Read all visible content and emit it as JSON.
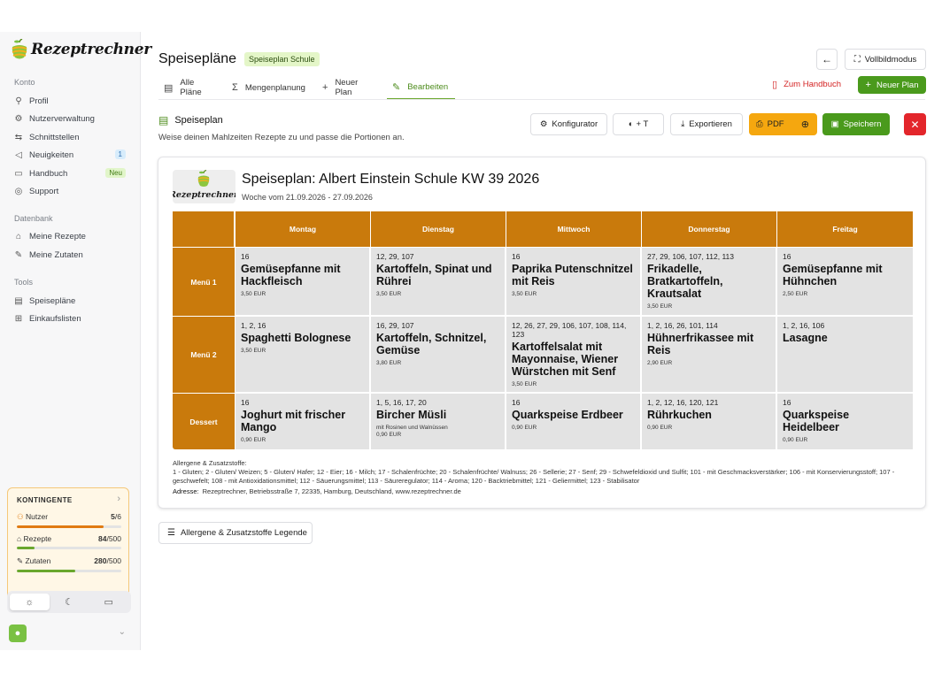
{
  "brand": {
    "name": "Rezeptrechner"
  },
  "sidebar": {
    "konto_label": "Konto",
    "konto_items": [
      {
        "label": "Profil",
        "icon": "user-icon"
      },
      {
        "label": "Nutzerverwaltung",
        "icon": "users-gear-icon"
      },
      {
        "label": "Schnittstellen",
        "icon": "plug-icon"
      },
      {
        "label": "Neuigkeiten",
        "icon": "megaphone-icon",
        "badge": "1"
      },
      {
        "label": "Handbuch",
        "icon": "book-icon",
        "badge": "Neu"
      },
      {
        "label": "Support",
        "icon": "support-icon"
      }
    ],
    "datenbank_label": "Datenbank",
    "datenbank_items": [
      {
        "label": "Meine Rezepte",
        "icon": "chef-hat-icon"
      },
      {
        "label": "Meine Zutaten",
        "icon": "carrot-icon"
      }
    ],
    "tools_label": "Tools",
    "tools_items": [
      {
        "label": "Speisepläne",
        "icon": "calendar-icon"
      },
      {
        "label": "Einkaufslisten",
        "icon": "basket-icon"
      }
    ],
    "quota": {
      "title": "KONTINGENTE",
      "rows": [
        {
          "label": "Nutzer",
          "used": "5",
          "total": "6",
          "fraction": 0.83,
          "color": "#e07b12"
        },
        {
          "label": "Rezepte",
          "used": "84",
          "total": "500",
          "fraction": 0.17,
          "color": "#6aa72d"
        },
        {
          "label": "Zutaten",
          "used": "280",
          "total": "500",
          "fraction": 0.56,
          "color": "#6aa72d"
        }
      ]
    }
  },
  "header": {
    "title": "Speisepläne",
    "tag": "Speiseplan Schule",
    "fullscreen_label": "Vollbildmodus",
    "handbuch_link": "Zum Handbuch",
    "new_plan_button": "Neuer Plan",
    "tabs": [
      {
        "label": "Alle Pläne",
        "icon": "calendar-icon"
      },
      {
        "label": "Mengenplanung",
        "icon": "sigma-icon"
      },
      {
        "label": "Neuer Plan",
        "icon": "plus-icon"
      },
      {
        "label": "Bearbeiten",
        "icon": "pencil-icon"
      }
    ]
  },
  "section": {
    "title": "Speiseplan",
    "subtitle": "Weise deinen Mahlzeiten Rezepte zu und passe die Portionen an.",
    "konfigurator": "Konfigurator",
    "style_label": "+ T",
    "export": "Exportieren",
    "pdf": "PDF",
    "save": "Speichern"
  },
  "plan": {
    "title": "Speiseplan: Albert Einstein Schule KW 39 2026",
    "week": "Woche vom 21.09.2026 - 27.09.2026",
    "days": [
      "Montag",
      "Dienstag",
      "Mittwoch",
      "Donnerstag",
      "Freitag"
    ],
    "rows": [
      {
        "label": "Menü 1",
        "cells": [
          {
            "allergens": "16",
            "name": "Gemüsepfanne mit Hackfleisch",
            "note": "",
            "price": "3,50 EUR"
          },
          {
            "allergens": "12, 29, 107",
            "name": "Kartoffeln, Spinat und Rührei",
            "note": "",
            "price": "3,50 EUR"
          },
          {
            "allergens": "16",
            "name": "Paprika Putenschnitzel mit Reis",
            "note": "",
            "price": "3,50 EUR"
          },
          {
            "allergens": "27, 29, 106, 107, 112, 113",
            "name": "Frikadelle, Bratkartoffeln, Krautsalat",
            "note": "",
            "price": "3,50 EUR"
          },
          {
            "allergens": "16",
            "name": "Gemüsepfanne mit Hühnchen",
            "note": "",
            "price": "2,50 EUR"
          }
        ]
      },
      {
        "label": "Menü 2",
        "cells": [
          {
            "allergens": "1, 2, 16",
            "name": "Spaghetti Bolognese",
            "note": "",
            "price": "3,50 EUR"
          },
          {
            "allergens": "16, 29, 107",
            "name": "Kartoffeln, Schnitzel, Gemüse",
            "note": "",
            "price": "3,80 EUR"
          },
          {
            "allergens": "12, 26, 27, 29, 106, 107, 108, 114, 123",
            "name": "Kartoffelsalat mit Mayonnaise, Wiener Würstchen mit Senf",
            "note": "",
            "price": "3,50 EUR"
          },
          {
            "allergens": "1, 2, 16, 26, 101, 114",
            "name": "Hühnerfrikassee mit Reis",
            "note": "",
            "price": "2,90 EUR"
          },
          {
            "allergens": "1, 2, 16, 106",
            "name": "Lasagne",
            "note": "",
            "price": ""
          }
        ]
      },
      {
        "label": "Dessert",
        "cells": [
          {
            "allergens": "16",
            "name": "Joghurt mit frischer Mango",
            "note": "",
            "price": "0,90 EUR"
          },
          {
            "allergens": "1, 5, 16, 17, 20",
            "name": "Bircher Müsli",
            "note": "mit Rosinen und Walnüssen",
            "price": "0,90 EUR"
          },
          {
            "allergens": "16",
            "name": "Quarkspeise Erdbeer",
            "note": "",
            "price": "0,90 EUR"
          },
          {
            "allergens": "1, 2, 12, 16, 120, 121",
            "name": "Rührkuchen",
            "note": "",
            "price": "0,90 EUR"
          },
          {
            "allergens": "16",
            "name": "Quarkspeise Heidelbeer",
            "note": "",
            "price": "0,90 EUR"
          }
        ]
      }
    ],
    "allergen_title": "Allergene & Zusatzstoffe:",
    "allergen_text": "1 - Gluten; 2 - Gluten/ Weizen; 5 - Gluten/ Hafer; 12 - Eier; 16 - Milch; 17 - Schalenfrüchte; 20 - Schalenfrüchte/ Walnuss; 26 - Sellerie; 27 - Senf; 29 - Schwefeldioxid und Sulfit; 101 - mit Geschmacksverstärker; 106 - mit Konservierungsstoff; 107 - geschwefelt; 108 - mit Antioxidationsmittel; 112 - Säuerungsmittel; 113 - Säureregulator; 114 - Aroma; 120 - Backtriebmittel; 121 - Geliermittel; 123 - Stabilisator",
    "address_label": "Adresse:",
    "address": "Rezeptrechner, Betriebsstraße 7, 22335, Hamburg, Deutschland, www.rezeptrechner.de"
  },
  "legend_button": "Allergene & Zusatzstoffe Legende",
  "colors": {
    "accent": "#4d8c1c",
    "primary_button": "#4a9a1c",
    "table_header": "#c97a0c",
    "pdf_button": "#f5a70f",
    "danger": "#e3262b"
  }
}
